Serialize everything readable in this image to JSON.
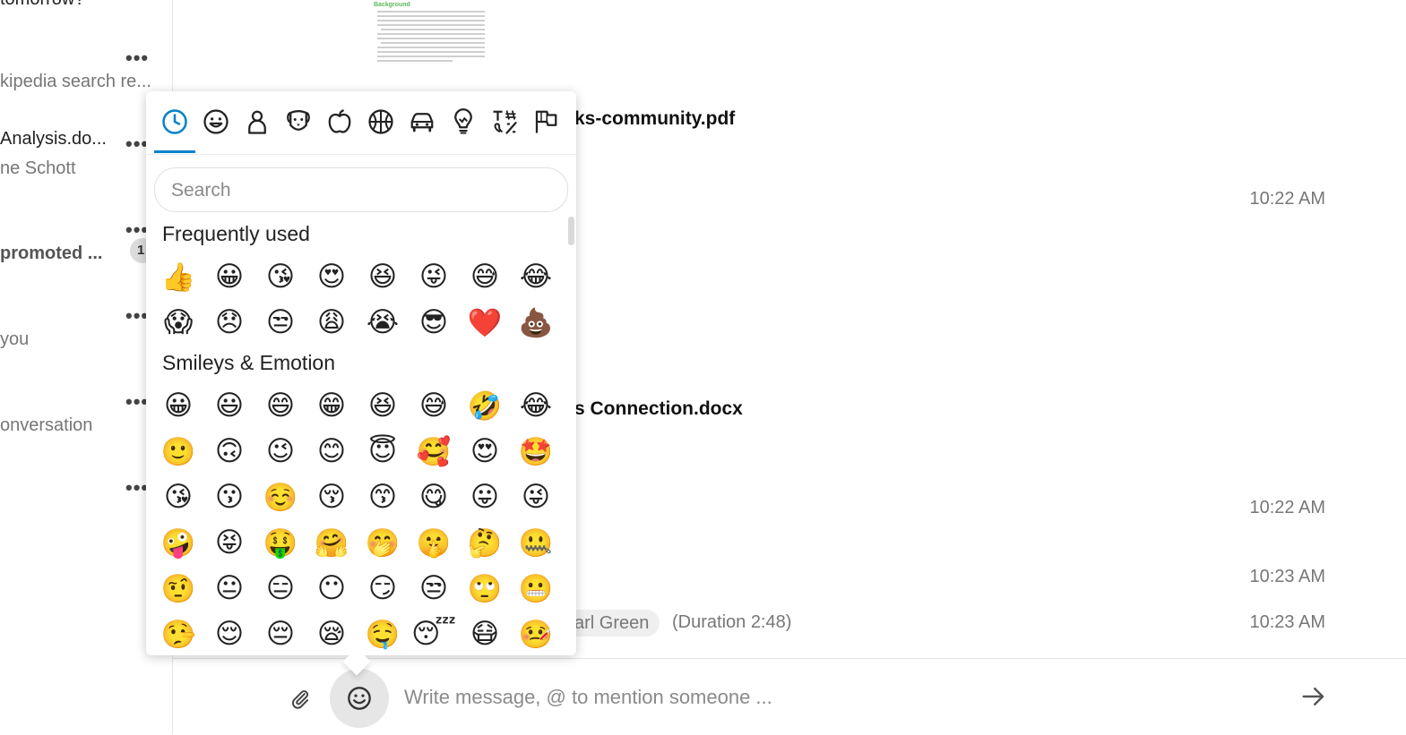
{
  "sidebar": {
    "conversations": [
      {
        "line1": "tomorrow?",
        "line2": "",
        "more": "•••"
      },
      {
        "line1": "kipedia search re...",
        "line2": "",
        "more": "•••"
      },
      {
        "line1": "Analysis.do...",
        "line2": "ne Schott",
        "more": "•••"
      },
      {
        "line1": "promoted ...",
        "line2": "",
        "more": "•••",
        "badge": "1"
      },
      {
        "line1": "you",
        "line2": "",
        "more": "•••"
      },
      {
        "line1": "onversation",
        "line2": "",
        "more": "•••"
      },
      {
        "line1": "",
        "line2": "",
        "more": "•••"
      }
    ]
  },
  "chat": {
    "preview_heading": "Background",
    "files": [
      {
        "name": "ks-community.pdf"
      },
      {
        "name": "s Connection.docx"
      }
    ],
    "timestamps": [
      "10:22 AM",
      "10:22 AM",
      "10:23 AM",
      "10:23 AM"
    ],
    "call": {
      "participant": "arl Green",
      "duration": "(Duration 2:48)"
    },
    "stray_mark": "l"
  },
  "composer": {
    "placeholder": "Write message, @ to mention someone ...",
    "attach_icon": "paperclip-icon",
    "emoji_icon": "smiley-icon",
    "send_icon": "arrow-right-icon"
  },
  "emoji_picker": {
    "categories": [
      {
        "name": "recent",
        "icon": "clock-icon",
        "active": true
      },
      {
        "name": "smileys",
        "icon": "smiley-icon"
      },
      {
        "name": "people",
        "icon": "person-icon"
      },
      {
        "name": "animals",
        "icon": "dog-icon"
      },
      {
        "name": "food",
        "icon": "apple-icon"
      },
      {
        "name": "activities",
        "icon": "basketball-icon"
      },
      {
        "name": "travel",
        "icon": "car-icon"
      },
      {
        "name": "objects",
        "icon": "lightbulb-icon"
      },
      {
        "name": "symbols",
        "icon": "symbols-icon"
      },
      {
        "name": "flags",
        "icon": "flags-icon"
      }
    ],
    "search_placeholder": "Search",
    "accent_color": "#0082c9",
    "sections": [
      {
        "title": "Frequently used",
        "rows": [
          [
            "👍",
            "😀",
            "😘",
            "😍",
            "😆",
            "😜",
            "😅",
            "😂"
          ],
          [
            "😱",
            "😞",
            "😒",
            "😩",
            "😭",
            "😎",
            "❤️",
            "💩"
          ]
        ]
      },
      {
        "title": "Smileys & Emotion",
        "rows": [
          [
            "😀",
            "😃",
            "😄",
            "😁",
            "😆",
            "😅",
            "🤣",
            "😂"
          ],
          [
            "🙂",
            "🙃",
            "😉",
            "😊",
            "😇",
            "🥰",
            "😍",
            "🤩"
          ],
          [
            "😘",
            "😗",
            "☺️",
            "😚",
            "😙",
            "😋",
            "😛",
            "😜"
          ],
          [
            "🤪",
            "😝",
            "🤑",
            "🤗",
            "🤭",
            "🤫",
            "🤔",
            "🤐"
          ],
          [
            "🤨",
            "😐",
            "😑",
            "😶",
            "😏",
            "😒",
            "🙄",
            "😬"
          ],
          [
            "🤥",
            "😌",
            "😔",
            "😪",
            "🤤",
            "😴",
            "😷",
            "🤒"
          ]
        ]
      }
    ]
  }
}
